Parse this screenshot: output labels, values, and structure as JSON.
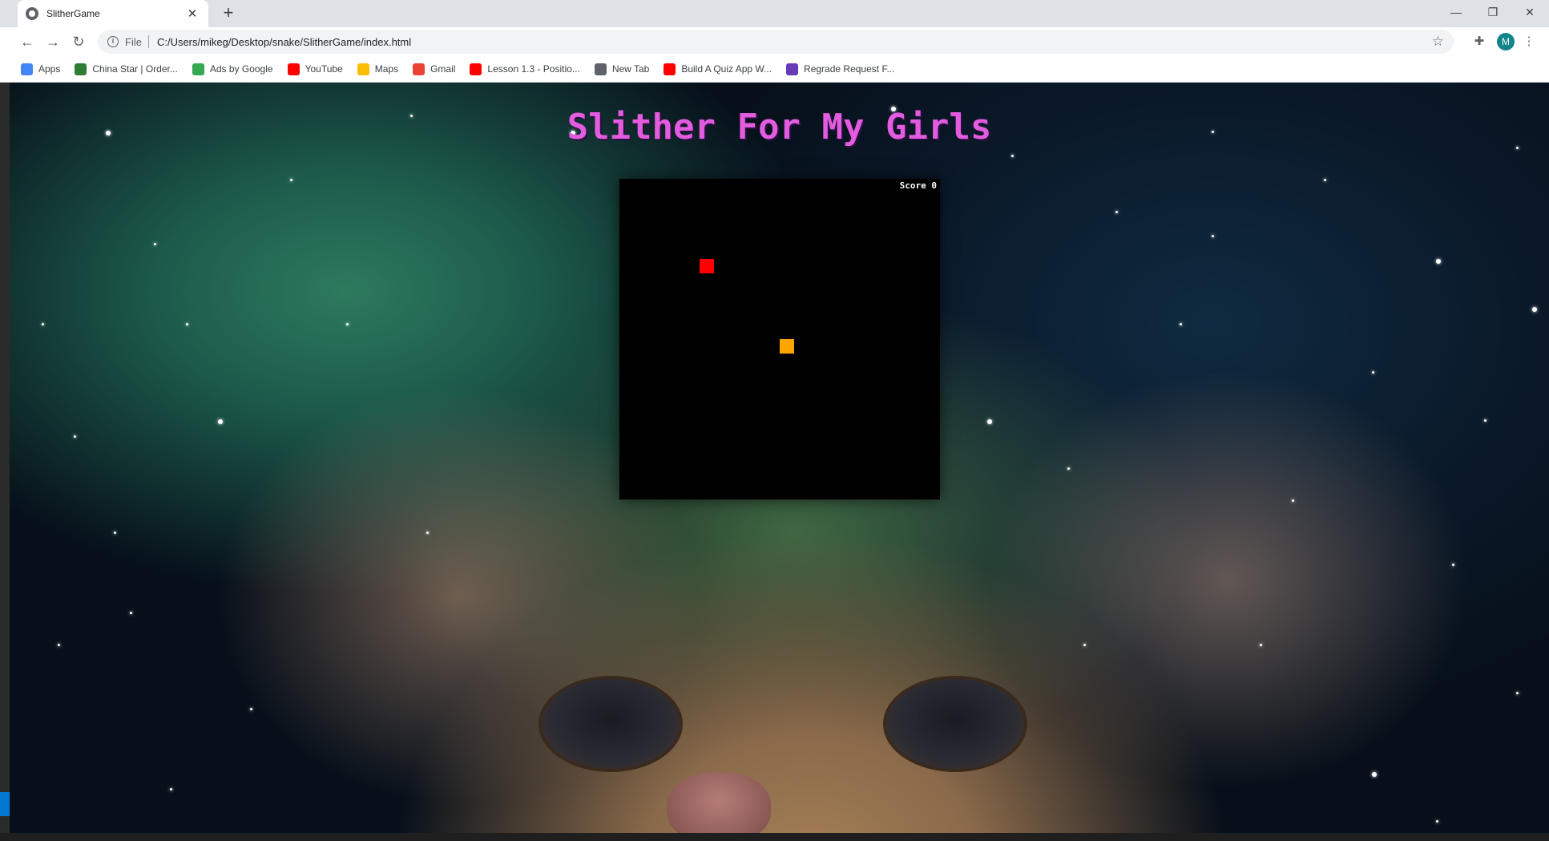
{
  "browser": {
    "tab_title": "SlitherGame",
    "tab_close": "✕",
    "new_tab": "+",
    "scheme_label": "File",
    "url": "C:/Users/mikeg/Desktop/snake/SlitherGame/index.html",
    "avatar_initial": "M",
    "window_controls": {
      "minimize": "—",
      "restore": "❐",
      "close": "✕"
    }
  },
  "bookmarks": [
    {
      "label": "Apps",
      "icon": "apps-grid-icon",
      "color": "#4285f4"
    },
    {
      "label": "China Star | Order...",
      "icon": "china-star-icon",
      "color": "#2e7d32"
    },
    {
      "label": "Ads by Google",
      "icon": "google-ads-icon",
      "color": "#34a853"
    },
    {
      "label": "YouTube",
      "icon": "youtube-icon",
      "color": "#ff0000"
    },
    {
      "label": "Maps",
      "icon": "maps-icon",
      "color": "#fbbc04"
    },
    {
      "label": "Gmail",
      "icon": "gmail-icon",
      "color": "#ea4335"
    },
    {
      "label": "Lesson 1.3 - Positio...",
      "icon": "youtube-icon",
      "color": "#ff0000"
    },
    {
      "label": "New Tab",
      "icon": "globe-icon",
      "color": "#5f6368"
    },
    {
      "label": "Build A Quiz App W...",
      "icon": "youtube-icon",
      "color": "#ff0000"
    },
    {
      "label": "Regrade Request F...",
      "icon": "forms-icon",
      "color": "#673ab7"
    }
  ],
  "game": {
    "title": "Slither For My Girls",
    "score_label": "Score 0",
    "food_color": "#ff0000",
    "snake_color": "#ffa500"
  }
}
